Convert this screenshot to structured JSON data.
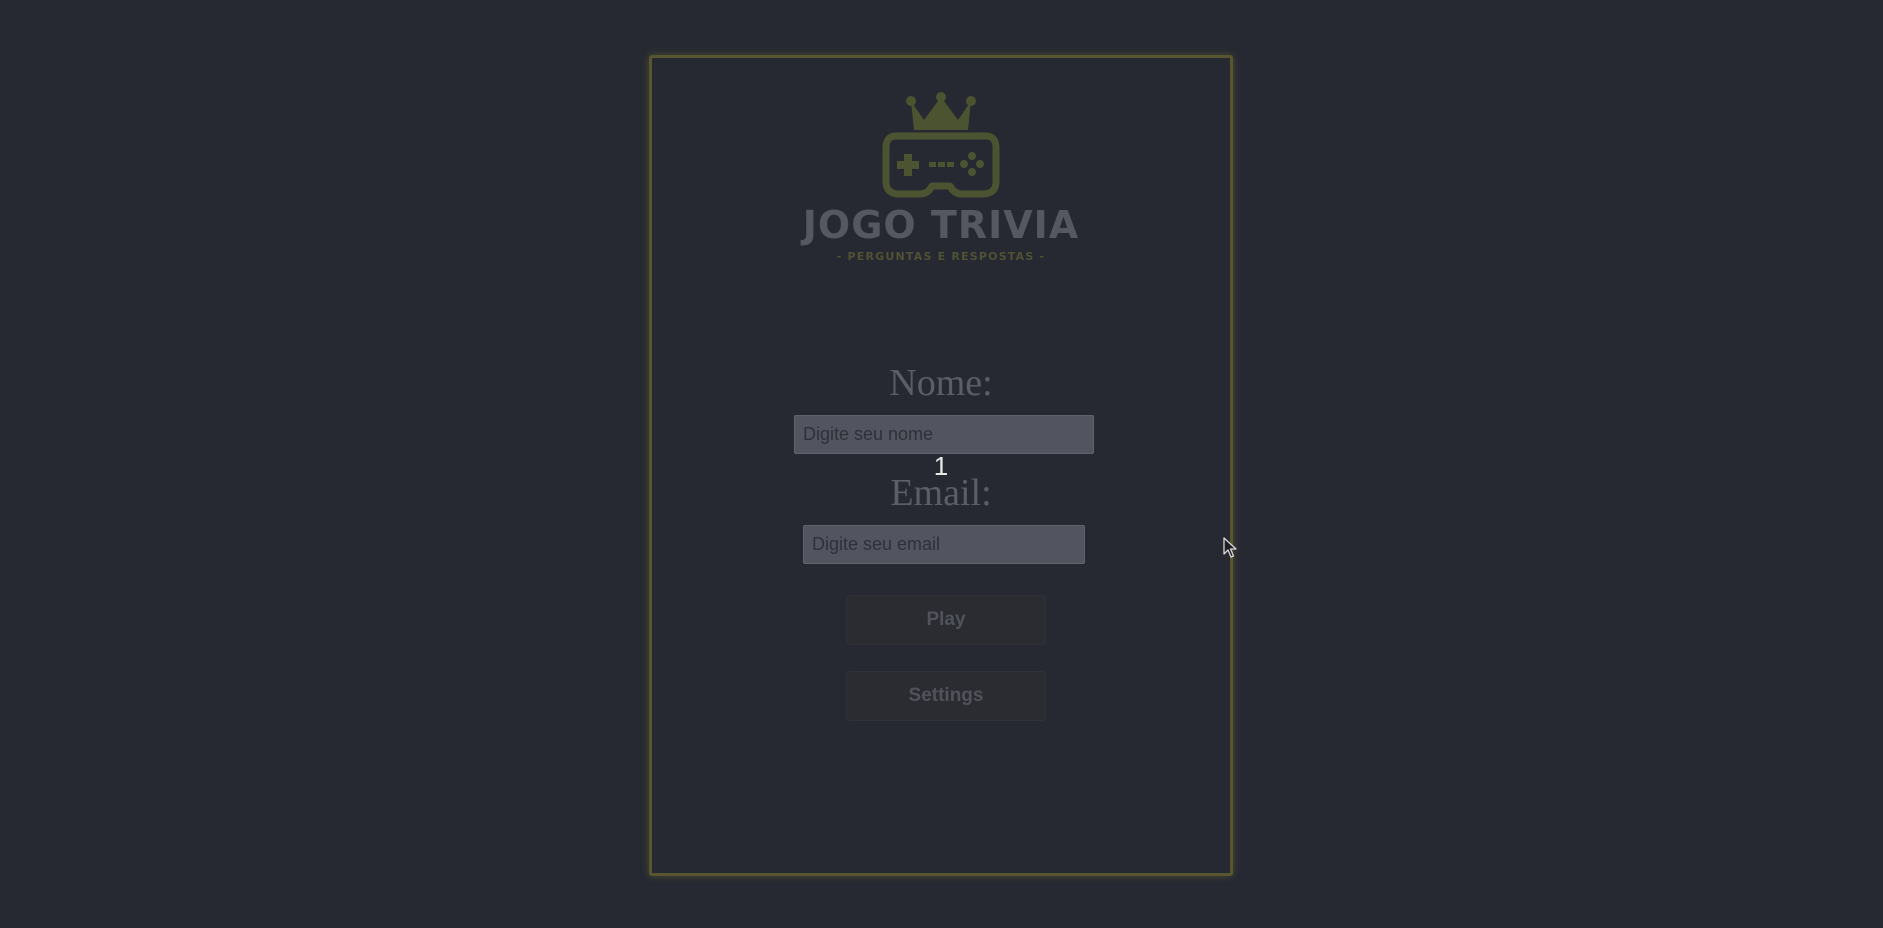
{
  "logo": {
    "title": "JOGO TRIVIA",
    "subtitle": "- PERGUNTAS E RESPOSTAS -",
    "icon": "crowned-gamepad-icon"
  },
  "form": {
    "name_label": "Nome:",
    "name_placeholder": "Digite seu nome",
    "name_value": "",
    "overlay_number": "1",
    "email_label": "Email:",
    "email_placeholder": "Digite seu email",
    "email_value": ""
  },
  "buttons": {
    "play_label": "Play",
    "settings_label": "Settings"
  },
  "colors": {
    "background": "#262932",
    "card_border": "#57562f",
    "accent_logo": "#4b5330"
  }
}
